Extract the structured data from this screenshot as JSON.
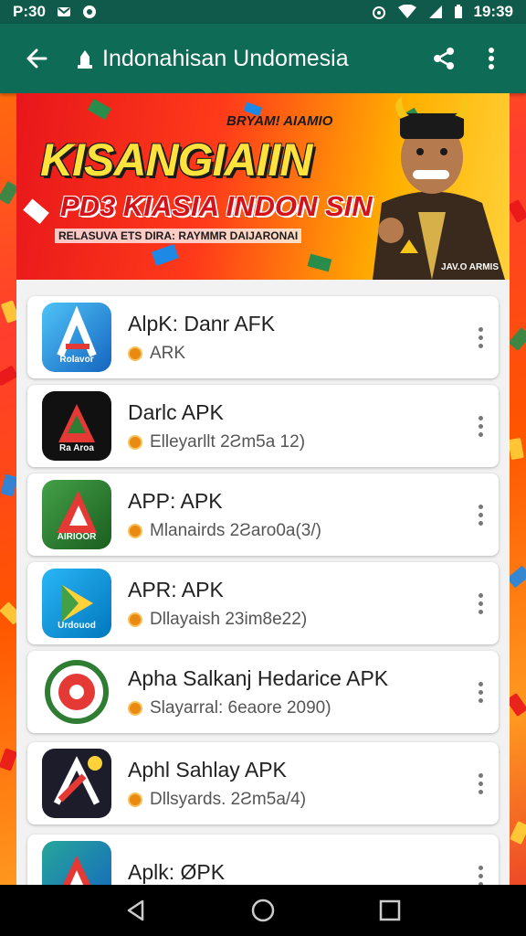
{
  "status_bar": {
    "time_left": "P:30",
    "time_right": "19:39"
  },
  "app_bar": {
    "title": "Indonahisan Undomesia"
  },
  "banner": {
    "top_text": "BRYAM! AIAMIO",
    "headline": "KISANGIAIIN",
    "subheadline": "PD3 KIASIA INDON SIN",
    "tagline": "RELASUVA ETS DIRA: RAYMMR DAIJARONAI",
    "caption": "JAV.O ARMIS"
  },
  "apps": [
    {
      "name": "AlpK: Danr AFK",
      "meta": "ARK",
      "icon": "apk-a-blue-icon",
      "icon_label": "Rolavor"
    },
    {
      "name": "Darlc APK",
      "meta": "Elleyarllt 2Ƨm5a 12)",
      "icon": "apk-a-black-icon",
      "icon_label": "Ra Aroa"
    },
    {
      "name": "APP: APK",
      "meta": "Mlanairds 2Ƨaro0a(3/)",
      "icon": "apk-a-green-icon",
      "icon_label": "AIRIOOR"
    },
    {
      "name": "APR: APK",
      "meta": "Dllayaish 23im8e22)",
      "icon": "apk-play-blue-icon",
      "icon_label": "Urdouod"
    },
    {
      "name": "Apha Salkanj Hedarice APK",
      "meta": "Slayarral: 6eaore 2090)",
      "icon": "apk-round-badge-icon",
      "icon_label": ""
    },
    {
      "name": "Aphl Sahlay APK",
      "meta": "Dllsyards. 2Ƨm5a/4)",
      "icon": "apk-a-dark-icon",
      "icon_label": ""
    },
    {
      "name": "Aplk: ØPK",
      "meta": "",
      "icon": "apk-a-teal-icon",
      "icon_label": ""
    }
  ],
  "colors": {
    "app_bar": "#0e6b56",
    "status_bar": "#0f5a4a",
    "accent": "#e98a12"
  }
}
